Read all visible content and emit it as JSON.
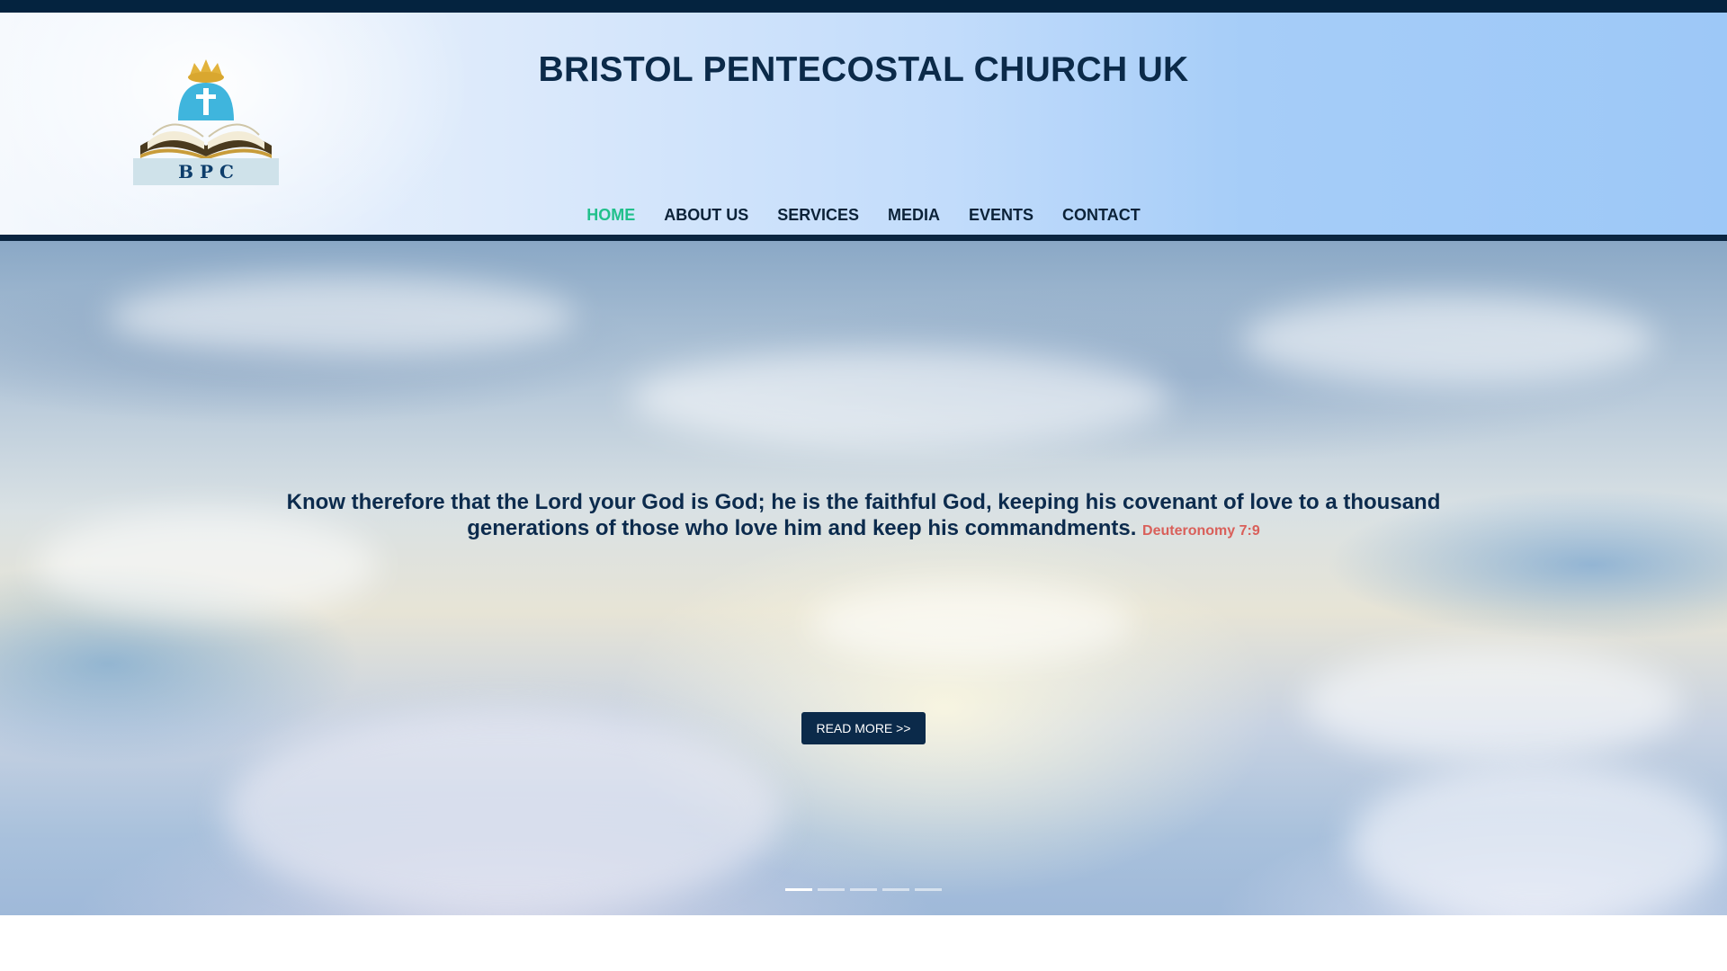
{
  "site": {
    "title": "BRISTOL PENTECOSTAL CHURCH UK",
    "logo_text": "B P C"
  },
  "nav": {
    "items": [
      {
        "label": "HOME",
        "active": true
      },
      {
        "label": "ABOUT US",
        "active": false
      },
      {
        "label": "SERVICES",
        "active": false
      },
      {
        "label": "MEDIA",
        "active": false
      },
      {
        "label": "EVENTS",
        "active": false
      },
      {
        "label": "CONTACT",
        "active": false
      }
    ],
    "active_color": "#21c08b"
  },
  "hero": {
    "verse": "Know therefore that the Lord your God is God; he is the faithful God, keeping his covenant of love to a thousand generations of those who love him and keep his commandments.",
    "reference": "Deuteronomy 7:9",
    "button_label": "READ MORE >>",
    "slides_total": 5,
    "active_slide": 1
  },
  "colors": {
    "navy": "#0b2a49",
    "reference_red": "#d9605a"
  }
}
